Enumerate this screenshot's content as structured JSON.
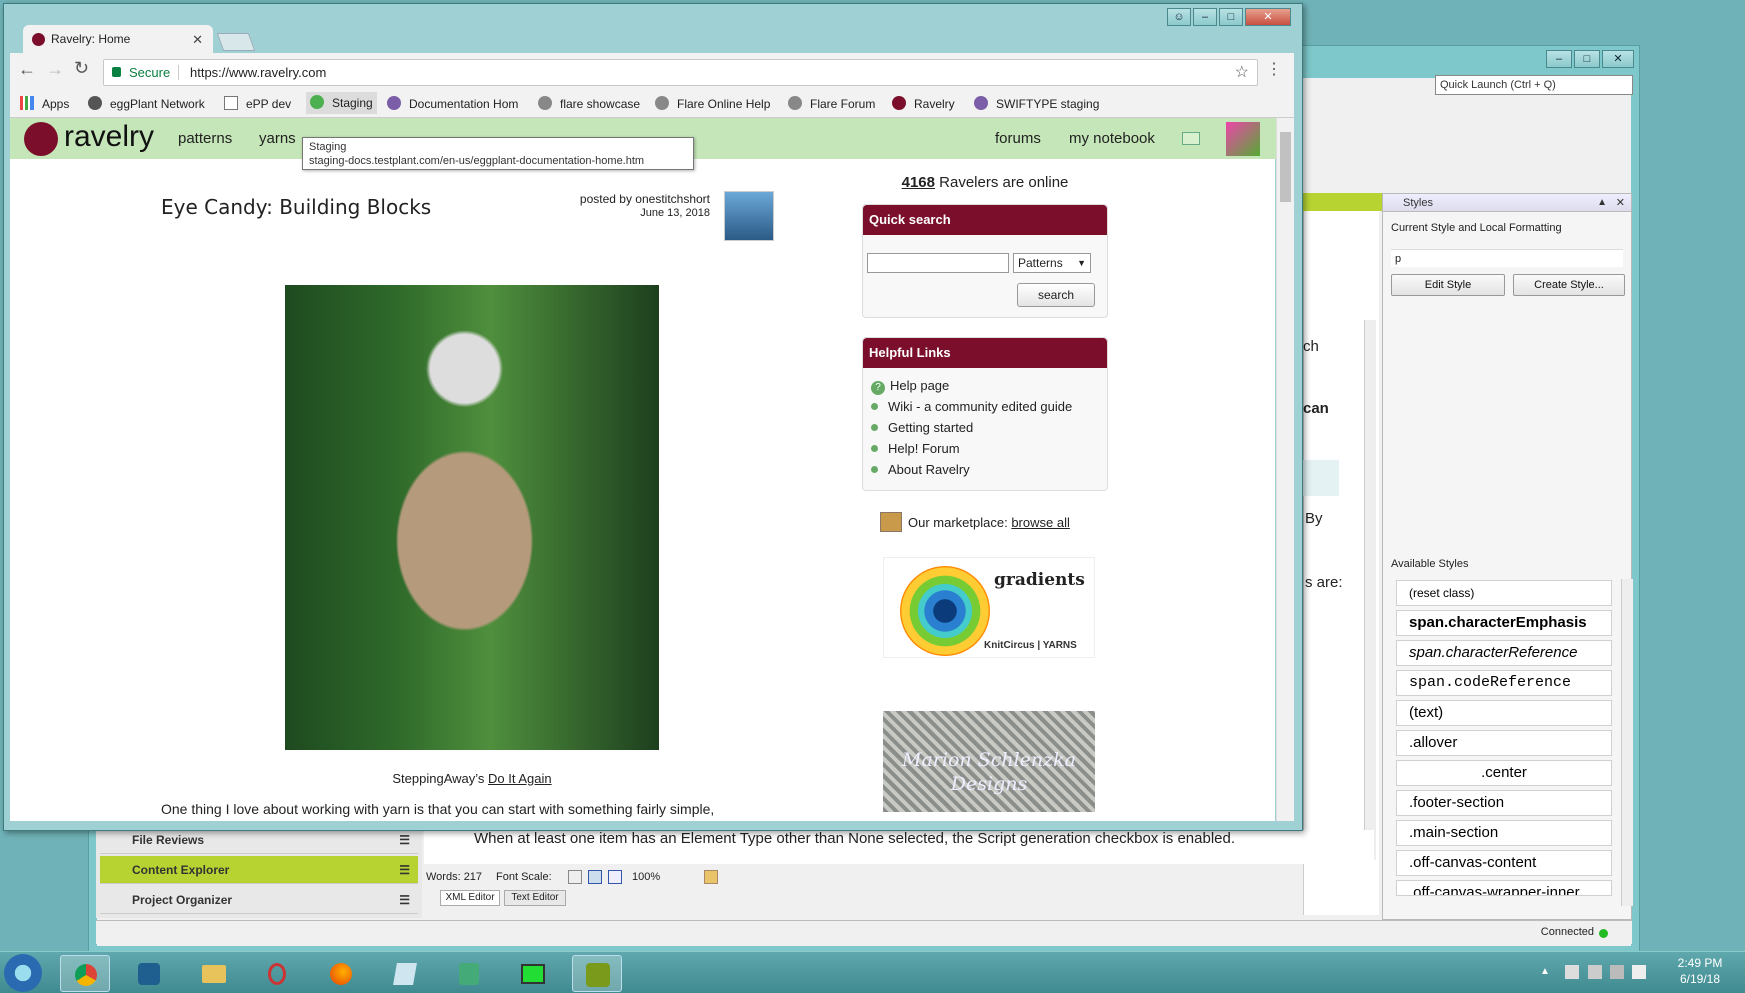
{
  "flare": {
    "quick_launch": "Quick Launch (Ctrl + Q)",
    "styles_panel": {
      "title": "Styles",
      "current_style_label": "Current Style and Local Formatting",
      "current_style_value": "p",
      "edit_style": "Edit Style",
      "create_style": "Create Style...",
      "available_label": "Available Styles",
      "items": [
        "(reset class)",
        "span.characterEmphasis",
        "span.characterReference",
        "span.codeReference",
        "(text)",
        ".allover",
        ".center",
        ".footer-section",
        ".main-section",
        ".off-canvas-content",
        ".off-canvas-wrapper-inner"
      ]
    },
    "editor_snippets": {
      "a": "ch",
      "b": "can",
      "c": "By",
      "d": "s are:"
    },
    "left_nav": [
      "File Reviews",
      "Content Explorer",
      "Project Organizer"
    ],
    "editor_sentence": "When at least one item has an Element Type other than None selected, the Script generation checkbox is enabled.",
    "words": "Words: 217",
    "font_scale_label": "Font Scale:",
    "zoom": "100%",
    "tabs": [
      "XML Editor",
      "Text Editor"
    ],
    "status": "Connected"
  },
  "chrome": {
    "tab_title": "Ravelry: Home",
    "secure_label": "Secure",
    "url": "https://www.ravelry.com",
    "bookmarks": [
      "Apps",
      "eggPlant Network",
      "ePP dev",
      "Staging",
      "Documentation Hom",
      "flare showcase",
      "Flare Online Help",
      "Flare Forum",
      "Ravelry",
      "SWIFTYPE staging"
    ],
    "tooltip_title": "Staging",
    "tooltip_url": "staging-docs.testplant.com/en-us/eggplant-documentation-home.htm"
  },
  "ravelry": {
    "logo": "ravelry",
    "nav": {
      "patterns": "patterns",
      "yarns": "yarns",
      "forums": "forums",
      "notebook": "my notebook"
    },
    "post_title": "Eye Candy: Building Blocks",
    "posted_by": "posted by onestitchshort",
    "post_date": "June 13, 2018",
    "caption_prefix": "SteppingAway’s ",
    "caption_link": "Do It Again",
    "body_text": "One thing I love about working with yarn is that you can start with something fairly simple,",
    "online_count": "4168",
    "online_text": " Ravelers are online",
    "quick_search": {
      "title": "Quick search",
      "select": "Patterns",
      "button": "search"
    },
    "helpful_links": {
      "title": "Helpful Links",
      "items": [
        "Help page",
        "Wiki - a community edited guide",
        "Getting started",
        "Help! Forum",
        "About Ravelry"
      ]
    },
    "marketplace_text": "Our marketplace: ",
    "marketplace_link": "browse all",
    "ad1": {
      "text": "gradients",
      "brand": "KnitCircus | YARNS"
    },
    "ad2": {
      "text1": "Marion Schlenzka",
      "text2": "Designs"
    }
  },
  "taskbar": {
    "time": "2:49 PM",
    "date": "6/19/18"
  },
  "colors": {
    "ravelry_red": "#7b0f2b",
    "ravelry_nav": "#c4e6b8",
    "content_explorer": "#b7d332"
  }
}
